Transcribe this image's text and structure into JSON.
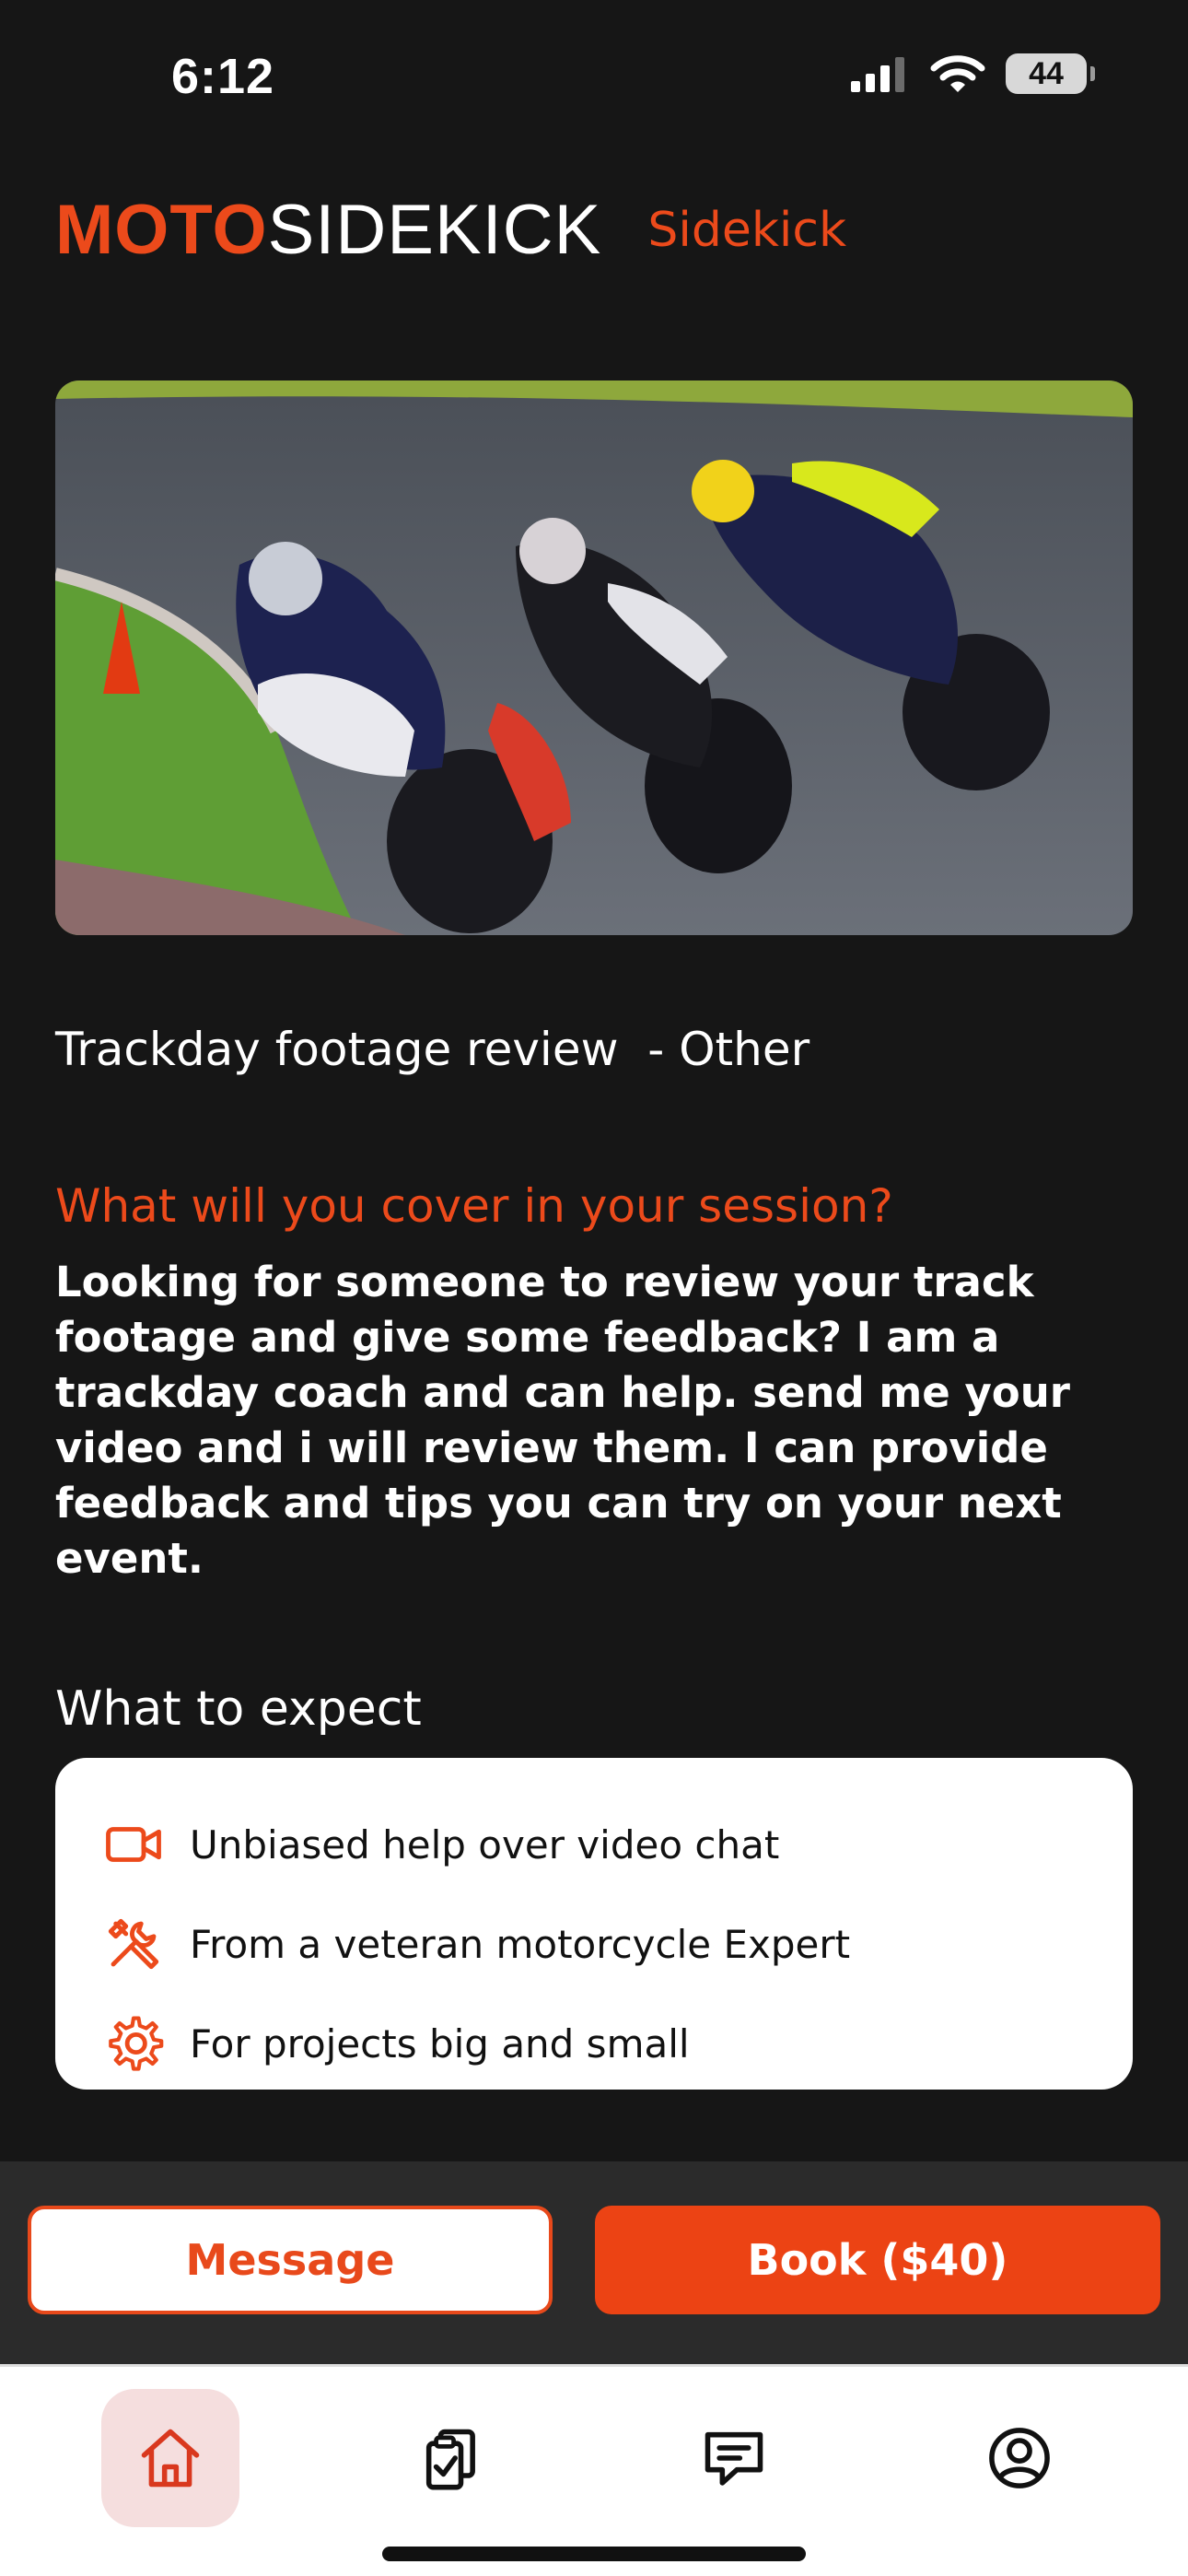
{
  "status_bar": {
    "time": "6:12",
    "battery": "44"
  },
  "header": {
    "logo_accent": "MOTO",
    "logo_main": "SIDEKICK",
    "tag": "Sidekick"
  },
  "session": {
    "title": "Trackday footage review  - Other",
    "cover_heading": "What will you cover in your session?",
    "description": "Looking for someone to review your track footage and give some feedback? I am a trackday coach and can help. send me your video and i will review them. I can provide feedback and tips you can try on your next event."
  },
  "expect": {
    "heading": "What to expect",
    "items": [
      {
        "icon": "video-camera-icon",
        "label": "Unbiased help over video chat"
      },
      {
        "icon": "tools-icon",
        "label": "From a veteran motorcycle Expert"
      },
      {
        "icon": "gear-icon",
        "label": "For projects big and small"
      }
    ]
  },
  "actions": {
    "message_label": "Message",
    "book_label": "Book ($40)"
  },
  "tab_bar": {
    "tabs": [
      {
        "icon": "home-icon",
        "active": true
      },
      {
        "icon": "clipboard-check-icon",
        "active": false
      },
      {
        "icon": "chat-icon",
        "active": false
      },
      {
        "icon": "profile-icon",
        "active": false
      }
    ]
  },
  "colors": {
    "accent": "#ec4a1b",
    "background": "#161616",
    "action_bar": "#2b2b2b"
  }
}
